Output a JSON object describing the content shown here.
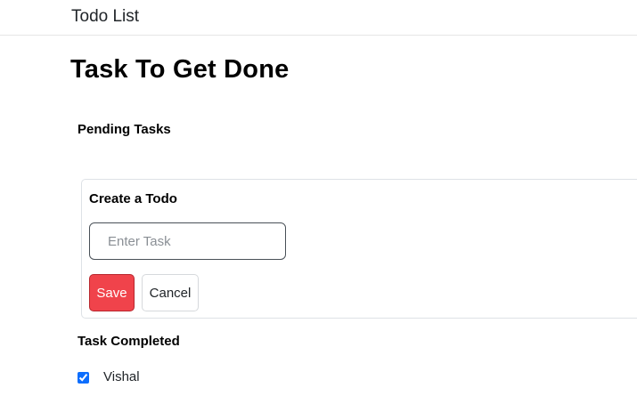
{
  "navbar": {
    "brand": "Todo List"
  },
  "page": {
    "title": "Task To Get Done"
  },
  "pending": {
    "title": "Pending Tasks"
  },
  "create_card": {
    "title": "Create a Todo",
    "input_value": "",
    "input_placeholder": "Enter Task",
    "save_label": "Save",
    "cancel_label": "Cancel",
    "save_color": "#f0434b"
  },
  "completed": {
    "title": "Task Completed",
    "items": [
      {
        "label": "Vishal",
        "checked": true
      }
    ]
  }
}
